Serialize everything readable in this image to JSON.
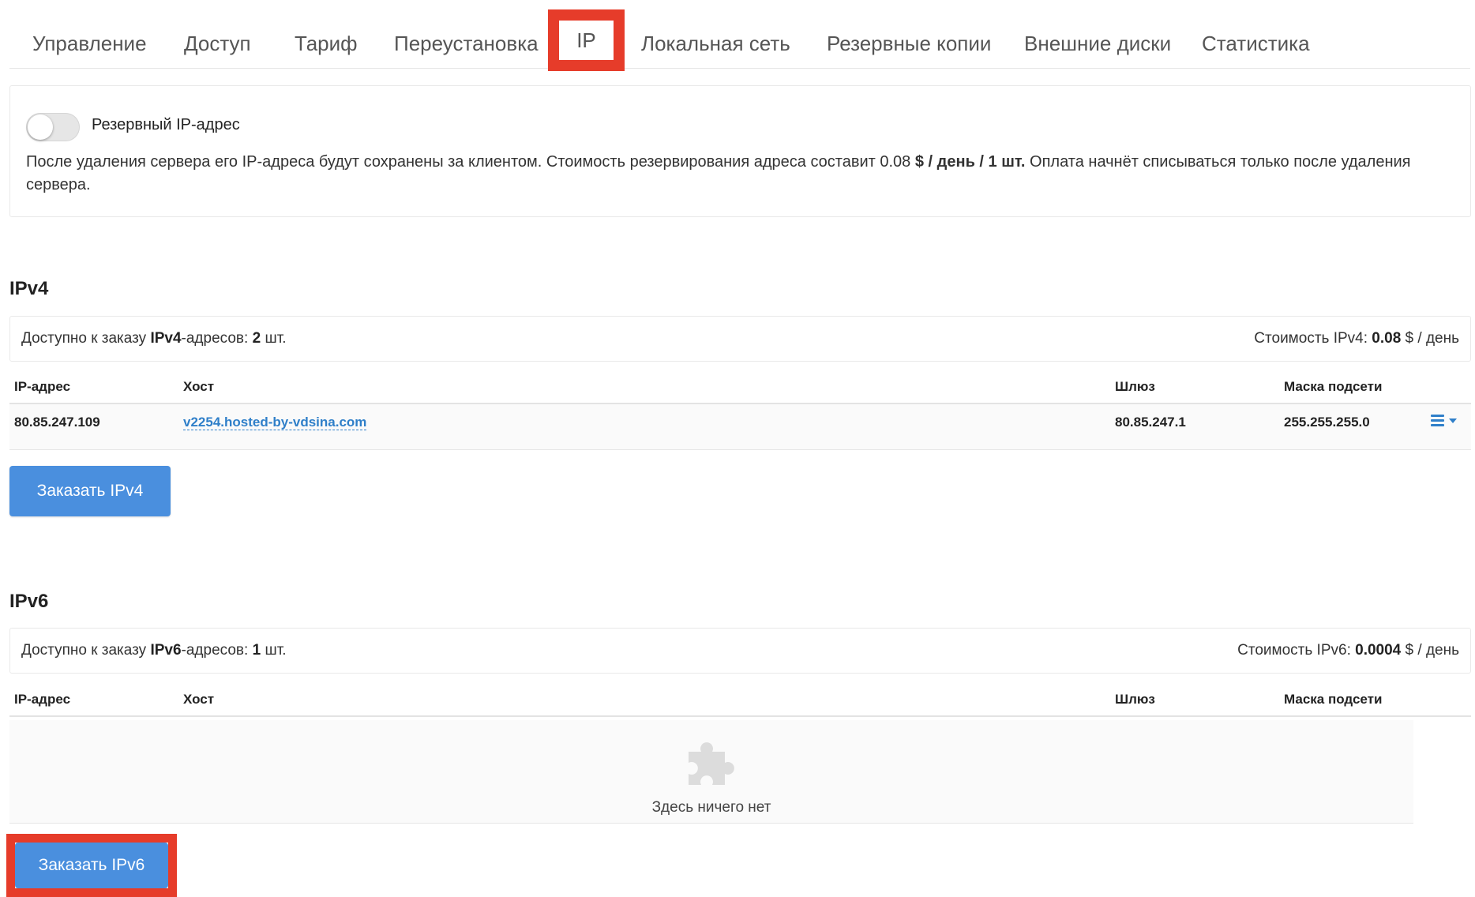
{
  "tabs": [
    {
      "label": "Управление"
    },
    {
      "label": "Доступ"
    },
    {
      "label": "Тариф"
    },
    {
      "label": "Переустановка"
    },
    {
      "label": "IP",
      "active": true
    },
    {
      "label": "Локальная сеть"
    },
    {
      "label": "Резервные копии"
    },
    {
      "label": "Внешние диски"
    },
    {
      "label": "Статистика"
    }
  ],
  "reserve": {
    "toggle_label": "Резервный IP-адрес",
    "toggle_on": false,
    "desc_part1": "После удаления сервера его IP-адреса будут сохранены за клиентом. Стоимость резервирования адреса составит 0.08",
    "desc_bold": "$ / день / 1 шт.",
    "desc_part2": "Оплата начнёт списываться только после удаления сервера."
  },
  "ipv4": {
    "title": "IPv4",
    "available_prefix": "Доступно к заказу",
    "available_kind": "IPv4",
    "available_suffix": "-адресов:",
    "available_count": "2",
    "available_unit": "шт.",
    "price_prefix": "Стоимость IPv4:",
    "price_value": "0.08",
    "price_unit": "$ / день",
    "columns": [
      "IP-адрес",
      "Хост",
      "Шлюз",
      "Маска подсети"
    ],
    "rows": [
      {
        "ip": "80.85.247.109",
        "host": "v2254.hosted-by-vdsina.com",
        "gateway": "80.85.247.1",
        "mask": "255.255.255.0"
      }
    ],
    "order_button": "Заказать IPv4"
  },
  "ipv6": {
    "title": "IPv6",
    "available_prefix": "Доступно к заказу",
    "available_kind": "IPv6",
    "available_suffix": "-адресов:",
    "available_count": "1",
    "available_unit": "шт.",
    "price_prefix": "Стоимость IPv6:",
    "price_value": "0.0004",
    "price_unit": "$ / день",
    "columns": [
      "IP-адрес",
      "Хост",
      "Шлюз",
      "Маска подсети"
    ],
    "empty_text": "Здесь ничего нет",
    "order_button": "Заказать IPv6"
  },
  "colors": {
    "accent": "#4a8fde",
    "link": "#2f7fc9",
    "highlight": "#e63c2a"
  }
}
